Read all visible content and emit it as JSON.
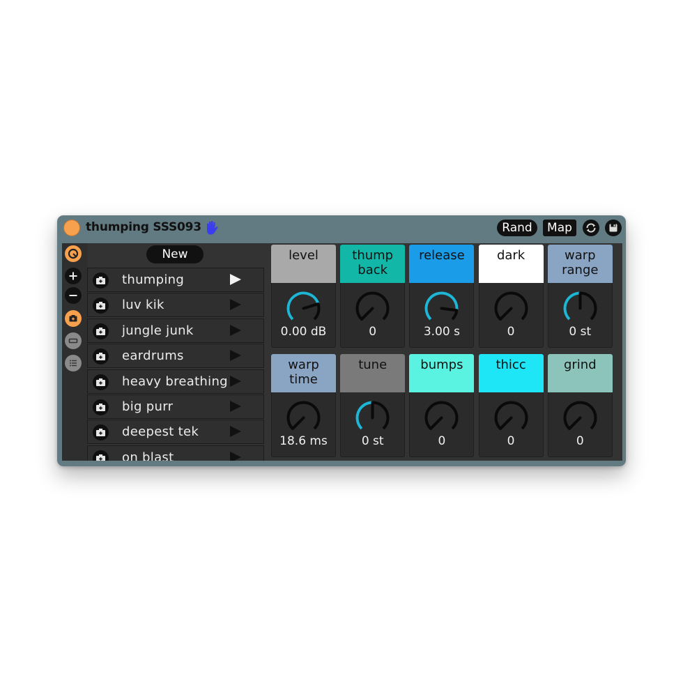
{
  "device": {
    "title": "thumping SSS093",
    "rand_label": "Rand",
    "map_label": "Map"
  },
  "presets": {
    "new_label": "New",
    "items": [
      {
        "label": "thumping"
      },
      {
        "label": "luv kik"
      },
      {
        "label": "jungle junk"
      },
      {
        "label": "eardrums"
      },
      {
        "label": "heavy breathing"
      },
      {
        "label": "big purr"
      },
      {
        "label": "deepest tek"
      },
      {
        "label": "on blast"
      }
    ]
  },
  "macros": [
    {
      "label_1": "level",
      "label_2": "",
      "header_color": "#a9a9a9",
      "value": "0.00 dB",
      "amount": 0.77,
      "bipolar": false
    },
    {
      "label_1": "thump",
      "label_2": "back",
      "header_color": "#12b7a8",
      "value": "0",
      "amount": 0.0,
      "bipolar": false
    },
    {
      "label_1": "release",
      "label_2": "",
      "header_color": "#1a9ce8",
      "value": "3.00 s",
      "amount": 0.86,
      "bipolar": false
    },
    {
      "label_1": "dark",
      "label_2": "",
      "header_color": "#ffffff",
      "value": "0",
      "amount": 0.0,
      "bipolar": false
    },
    {
      "label_1": "warp",
      "label_2": "range",
      "header_color": "#8aa4c4",
      "value": "0 st",
      "amount": 0.5,
      "bipolar": false
    },
    {
      "label_1": "warp",
      "label_2": "time",
      "header_color": "#8aa4c4",
      "value": "18.6 ms",
      "amount": 0.0,
      "bipolar": false
    },
    {
      "label_1": "tune",
      "label_2": "",
      "header_color": "#7a7a7a",
      "value": "0 st",
      "amount": 0.5,
      "bipolar": false
    },
    {
      "label_1": "bumps",
      "label_2": "",
      "header_color": "#5af2e0",
      "value": "0",
      "amount": 0.0,
      "bipolar": false
    },
    {
      "label_1": "thicc",
      "label_2": "",
      "header_color": "#1ee6f7",
      "value": "0",
      "amount": 0.0,
      "bipolar": false
    },
    {
      "label_1": "grind",
      "label_2": "",
      "header_color": "#8cc4bc",
      "value": "0",
      "amount": 0.0,
      "bipolar": false
    }
  ],
  "colors": {
    "accent": "#f7a04d",
    "knob_fill": "#1fb6d6",
    "panel": "#627a82",
    "hand_icon": "#3b3bf0"
  },
  "icons": {
    "power": "power-toggle-icon",
    "hand": "hand-icon",
    "sync": "sync-icon",
    "save": "save-icon",
    "side": [
      "hot-swap-icon",
      "plus-icon",
      "minus-icon",
      "camera-icon",
      "collapse-icon",
      "list-icon"
    ]
  }
}
